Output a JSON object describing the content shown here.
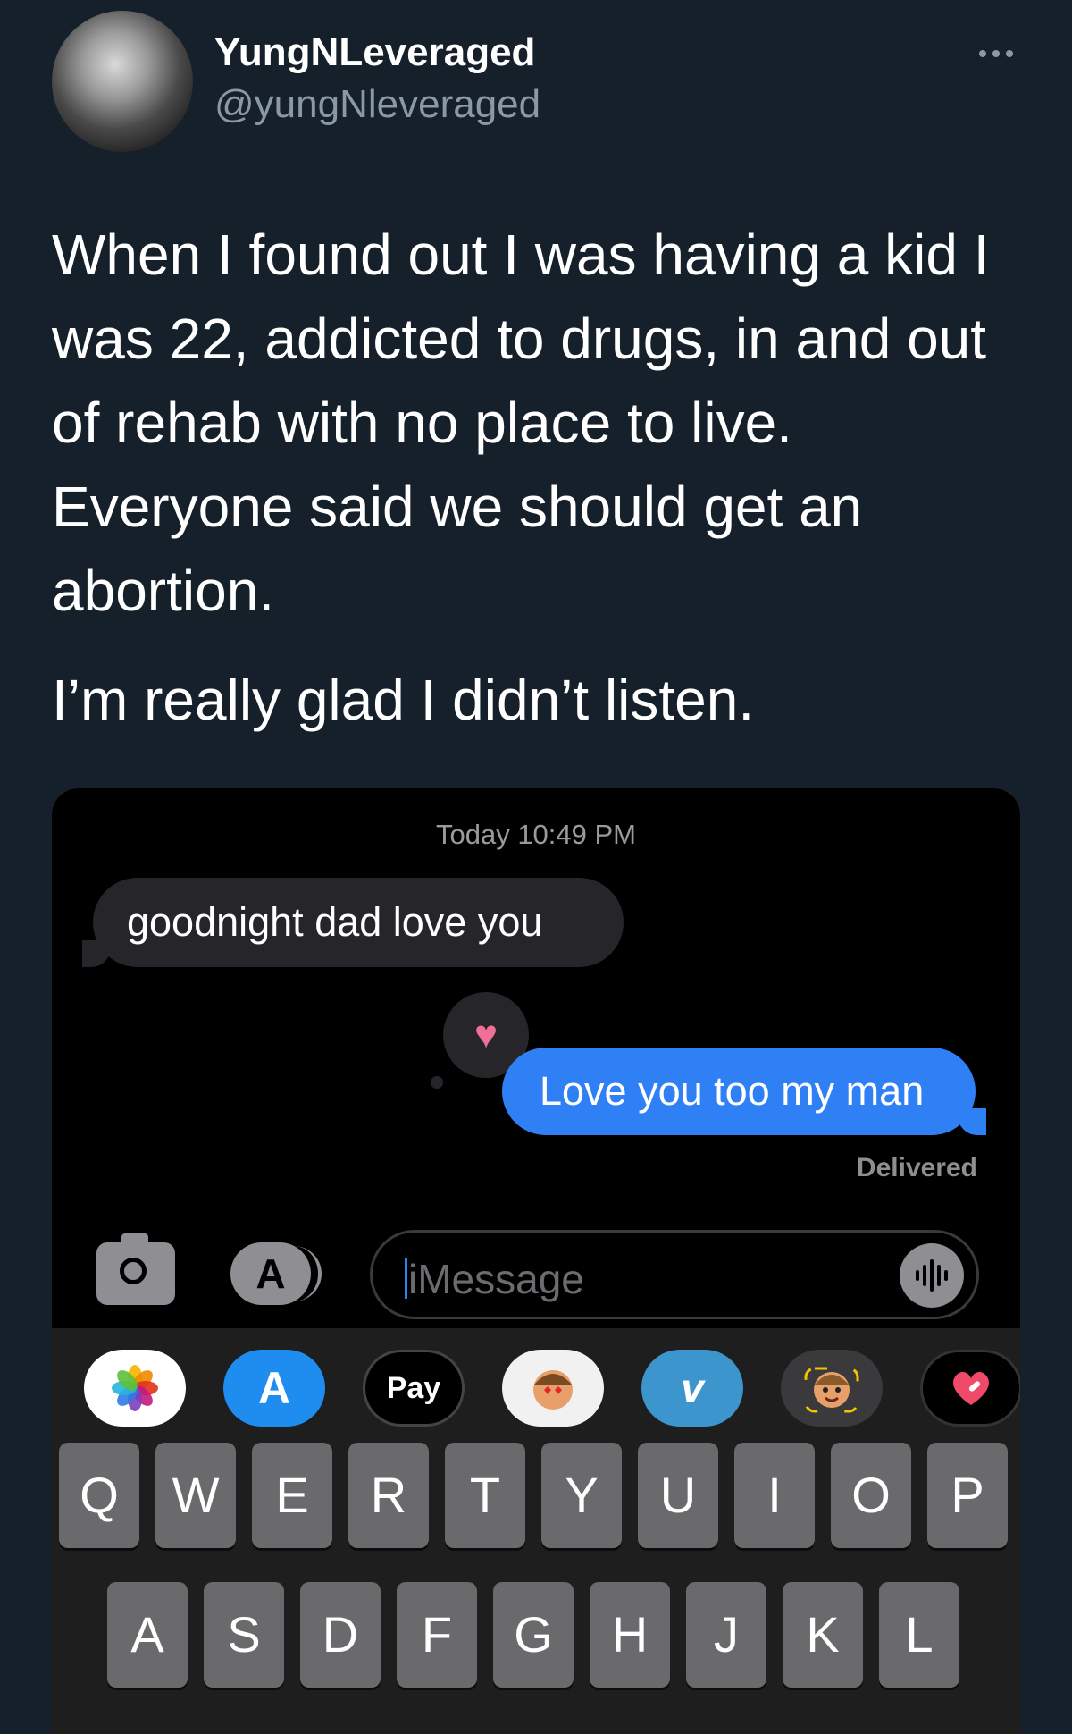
{
  "tweet": {
    "display_name": "YungNLeveraged",
    "handle": "@yungNleveraged",
    "text_paragraph_1": "When I found out I was having a kid I was 22, addicted to drugs, in and out of rehab with no place to live. Everyone said we should get an abortion.",
    "text_paragraph_2": "I’m really glad I didn’t listen."
  },
  "screenshot": {
    "timestamp": "Today 10:49 PM",
    "incoming_message": "goodnight dad love you",
    "tapback_icon": "heart-icon",
    "outgoing_message": "Love you too my man",
    "delivery_status": "Delivered",
    "input_placeholder": "iMessage",
    "app_strip": [
      "photos-icon",
      "app-store-icon",
      "Pay",
      "memoji-stickers-icon",
      "venmo-icon",
      "memoji-icon",
      "heart-app-icon"
    ],
    "keyboard_row_1": [
      "Q",
      "W",
      "E",
      "R",
      "T",
      "Y",
      "U",
      "I",
      "O",
      "P"
    ],
    "keyboard_row_2": [
      "A",
      "S",
      "D",
      "F",
      "G",
      "H",
      "J",
      "K",
      "L"
    ]
  },
  "colors": {
    "background": "#15202b",
    "secondary_text": "#8b98a5",
    "imessage_blue": "#2f7ff5",
    "tapback_heart": "#ef6f96"
  }
}
